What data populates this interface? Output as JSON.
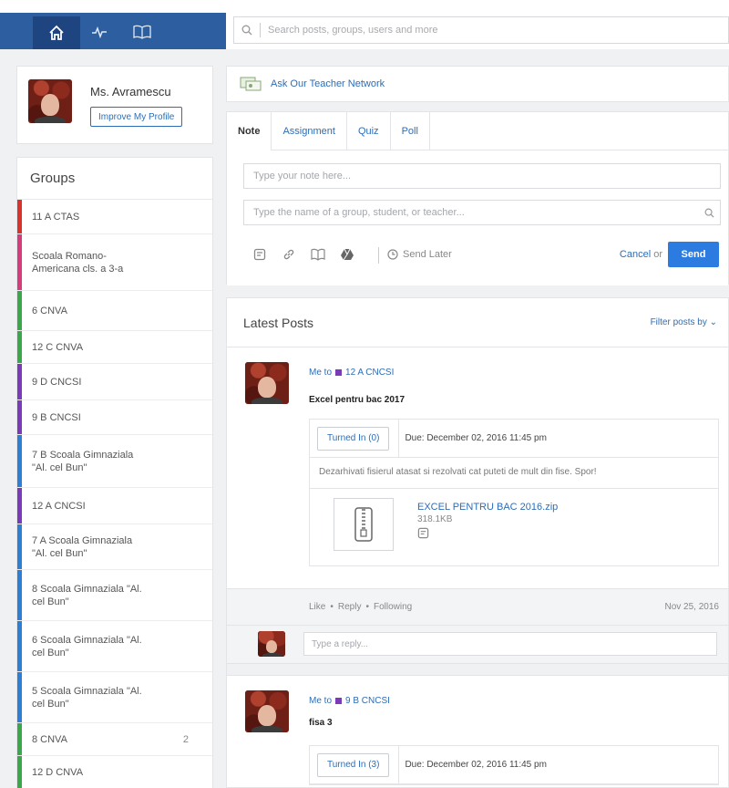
{
  "nav": {
    "search_placeholder": "Search posts, groups, users and more",
    "icons": [
      "home-icon",
      "activity-icon",
      "book-icon"
    ],
    "brand_color": "#2d5fa0"
  },
  "profile": {
    "name": "Ms. Avramescu",
    "improve_label": "Improve My Profile"
  },
  "groups": {
    "title": "Groups",
    "items": [
      {
        "label": "11 A CTAS",
        "color": "#d8342b",
        "h": 38
      },
      {
        "label": "Scoala Romano-\nAmericana cls. a 3-a",
        "color": "#d63b7b",
        "h": 62
      },
      {
        "label": "6 CNVA",
        "color": "#3aa84a",
        "h": 44
      },
      {
        "label": "12 C CNVA",
        "color": "#3aa84a",
        "h": 36
      },
      {
        "label": "9 D CNCSI",
        "color": "#7b3bb8",
        "h": 40
      },
      {
        "label": "9 B CNCSI",
        "color": "#7b3bb8",
        "h": 38
      },
      {
        "label": "7 B Scoala Gimnaziala\n\"Al. cel Bun\"",
        "color": "#2d7fd6",
        "h": 58
      },
      {
        "label": "12 A CNCSI",
        "color": "#7b3bb8",
        "h": 40
      },
      {
        "label": "7 A Scoala Gimnaziala\n\"Al. cel Bun\"",
        "color": "#2d7fd6",
        "h": 50
      },
      {
        "label": "8 Scoala Gimnaziala \"Al.\ncel Bun\"",
        "color": "#2d7fd6",
        "h": 56
      },
      {
        "label": "6 Scoala Gimnaziala \"Al.\ncel Bun\"",
        "color": "#2d7fd6",
        "h": 56
      },
      {
        "label": "5 Scoala Gimnaziala \"Al.\ncel Bun\"",
        "color": "#2d7fd6",
        "h": 56
      },
      {
        "label": "8 CNVA",
        "color": "#3aa84a",
        "h": 36,
        "count": "2"
      },
      {
        "label": "12 D CNVA",
        "color": "#3aa84a",
        "h": 36
      }
    ]
  },
  "ask": {
    "label": "Ask Our Teacher Network"
  },
  "composer": {
    "tabs": [
      "Note",
      "Assignment",
      "Quiz",
      "Poll"
    ],
    "note_placeholder": "Type your note here...",
    "to_placeholder": "Type the name of a group, student, or teacher...",
    "send_later": "Send Later",
    "cancel": "Cancel",
    "or": "or",
    "send": "Send"
  },
  "posts": {
    "title": "Latest Posts",
    "filter": "Filter posts by",
    "items": [
      {
        "from": "Me to",
        "group": "12 A CNCSI",
        "title": "Excel pentru bac 2017",
        "turned_in": "Turned In (0)",
        "due": "Due: December 02, 2016 11:45 pm",
        "desc": "Dezarhivati fisierul atasat si rezolvati cat puteti de mult din fise. Spor!",
        "file_name": "EXCEL PENTRU BAC 2016.zip",
        "file_size": "318.1KB",
        "like": "Like",
        "reply": "Reply",
        "following": "Following",
        "date": "Nov 25, 2016",
        "reply_placeholder": "Type a reply..."
      },
      {
        "from": "Me to",
        "group": "9 B CNCSI",
        "title": "fisa 3",
        "turned_in": "Turned In (3)",
        "due": "Due: December 02, 2016 11:45 pm"
      }
    ]
  }
}
